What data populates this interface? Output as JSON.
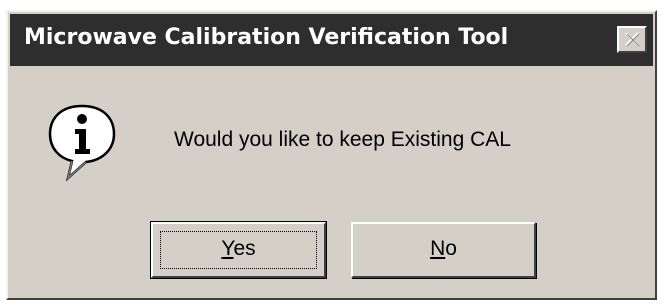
{
  "window": {
    "title": "Microwave Calibration Verification Tool"
  },
  "dialog": {
    "icon": "info-icon",
    "message": "Would you like to keep Existing CAL"
  },
  "buttons": {
    "yes": {
      "mnemonic": "Y",
      "rest": "es"
    },
    "no": {
      "mnemonic": "N",
      "rest": "o"
    }
  },
  "colors": {
    "face": "#d4d0c8",
    "titlebar": "#2e2e2e"
  }
}
